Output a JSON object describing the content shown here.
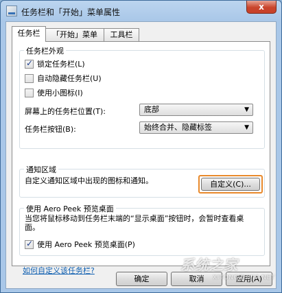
{
  "window": {
    "title": "任务栏和「开始」菜单属性",
    "close_label": "x"
  },
  "tabs": [
    {
      "label": "任务栏"
    },
    {
      "label": "「开始」菜单"
    },
    {
      "label": "工具栏"
    }
  ],
  "appearance": {
    "title": "任务栏外观",
    "lock": {
      "label": "锁定任务栏(L)",
      "checked": true
    },
    "autohide": {
      "label": "自动隐藏任务栏(U)",
      "checked": false
    },
    "small_icons": {
      "label": "使用小图标(I)",
      "checked": false
    },
    "position": {
      "label": "屏幕上的任务栏位置(T):",
      "value": "底部"
    },
    "buttons": {
      "label": "任务栏按钮(B):",
      "value": "始终合并、隐藏标签"
    }
  },
  "notification": {
    "title": "通知区域",
    "desc": "自定义通知区域中出现的图标和通知。",
    "customize_label": "自定义(C)...",
    "highlight_color": "#e8892b"
  },
  "aero_peek": {
    "title": "使用 Aero Peek 预览桌面",
    "desc": "当您将鼠标移动到任务栏末端的“显示桌面”按钮时，会暂时查看桌面。",
    "checkbox": {
      "label": "使用 Aero Peek 预览桌面(P)",
      "checked": true
    }
  },
  "help_link": "如何自定义该任务栏?",
  "footer": {
    "ok": "确定",
    "cancel": "取消",
    "apply": "应用(A)"
  },
  "watermark": {
    "main": "系统之家",
    "sub": "XITONGZHIJIA.NET"
  }
}
